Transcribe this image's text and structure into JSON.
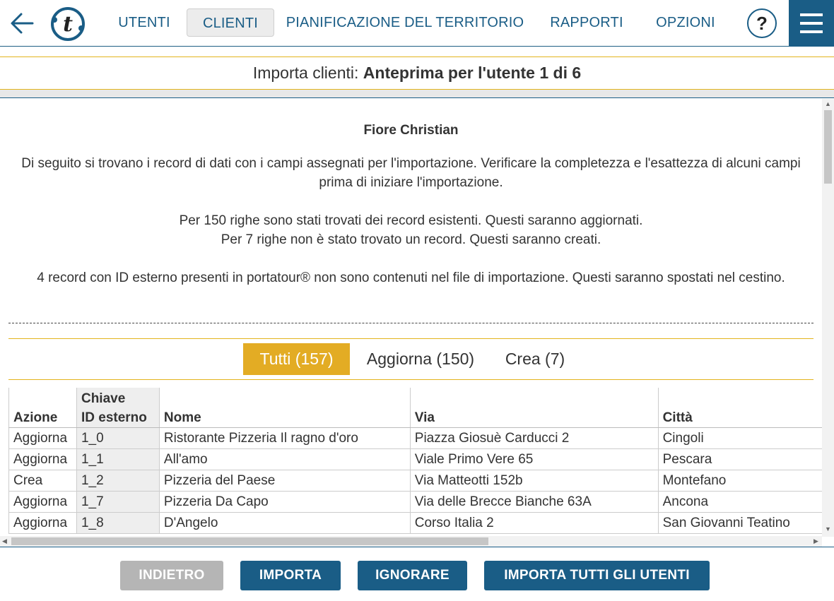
{
  "nav": {
    "items": [
      "UTENTI",
      "CLIENTI",
      "PIANIFICAZIONE DEL TERRITORIO",
      "RAPPORTI",
      "OPZIONI"
    ],
    "active": "CLIENTI",
    "help_label": "?"
  },
  "title": {
    "prefix": "Importa clienti:",
    "main": "Anteprima per l'utente 1 di 6"
  },
  "user_name": "Fiore Christian",
  "paragraphs": {
    "p1": "Di seguito si trovano i record di dati con i campi assegnati per l'importazione. Verificare la completezza e l'esattezza di alcuni campi prima di iniziare l'importazione.",
    "p2": "Per 150 righe sono stati trovati dei record esistenti. Questi saranno aggiornati.",
    "p3": "Per 7 righe non è stato trovato un record. Questi saranno creati.",
    "p4": "4 record con ID esterno presenti in portatour® non sono contenuti nel file di importazione. Questi saranno spostati nel cestino."
  },
  "tabs": [
    "Tutti (157)",
    "Aggiorna (150)",
    "Crea (7)"
  ],
  "table": {
    "headers": {
      "azione": "Azione",
      "chiave_1": "Chiave",
      "chiave_2": "ID esterno",
      "nome": "Nome",
      "via": "Via",
      "citta": "Città"
    },
    "rows": [
      [
        "Aggiorna",
        "1_0",
        "Ristorante Pizzeria Il ragno d'oro",
        "Piazza Giosuè Carducci 2",
        "Cingoli"
      ],
      [
        "Aggiorna",
        "1_1",
        "All'amo",
        "Viale Primo Vere 65",
        "Pescara"
      ],
      [
        "Crea",
        "1_2",
        "Pizzeria del Paese",
        "Via Matteotti 152b",
        "Montefano"
      ],
      [
        "Aggiorna",
        "1_7",
        "Pizzeria Da Capo",
        "Via delle Brecce Bianche 63A",
        "Ancona"
      ],
      [
        "Aggiorna",
        "1_8",
        "D'Angelo",
        "Corso Italia 2",
        "San Giovanni Teatino"
      ]
    ]
  },
  "buttons": {
    "back": "INDIETRO",
    "import": "IMPORTA",
    "ignore": "IGNORARE",
    "import_all": "IMPORTA TUTTI GLI UTENTI"
  },
  "colors": {
    "brand": "#1a5d86",
    "accent": "#e3ac24",
    "disabled": "#b5b5b5"
  }
}
